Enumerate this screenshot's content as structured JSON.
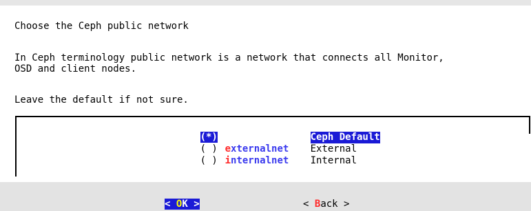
{
  "dialog": {
    "title_line": "Choose the Ceph public network",
    "description_line1": "In Ceph terminology public network is a network that connects all Monitor,",
    "description_line2": "OSD and client nodes.",
    "hint_line": "Leave the default if not sure."
  },
  "radio_list": {
    "items": [
      {
        "marker": "(*)",
        "tag": "",
        "tag_first": "",
        "tag_rest": "",
        "description": "Ceph Default",
        "selected": true
      },
      {
        "marker": "( )",
        "tag": "externalnet",
        "tag_first": "e",
        "tag_rest": "xternalnet",
        "description": "External",
        "selected": false
      },
      {
        "marker": "( )",
        "tag": "internalnet",
        "tag_first": "i",
        "tag_rest": "nternalnet",
        "description": "Internal",
        "selected": false
      }
    ]
  },
  "buttons": {
    "ok": {
      "left_bracket": "<",
      "hotkey": "O",
      "rest": "K",
      "right_bracket": ">"
    },
    "back": {
      "left_bracket": "<",
      "hotkey": "B",
      "rest": "ack",
      "right_bracket": ">"
    }
  },
  "colors": {
    "selection_bg": "#1a1ad6",
    "hotkey_red": "#ff2a2a",
    "tag_blue": "#3a3aee",
    "footer_bg": "#e3e3e3"
  }
}
